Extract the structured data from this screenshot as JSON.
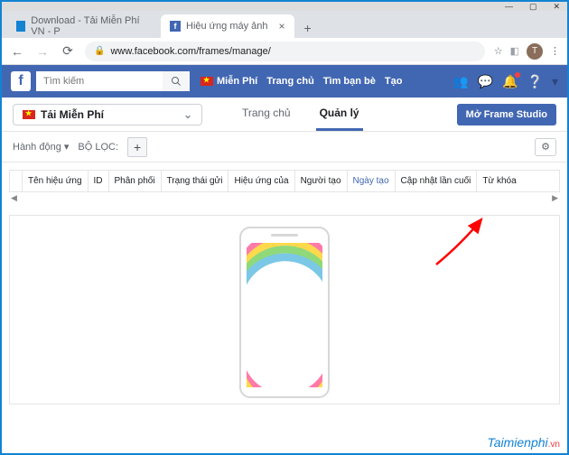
{
  "window": {
    "tab1": "Download - Tải Miễn Phí VN - P",
    "tab2": "Hiệu ứng máy ảnh"
  },
  "browser": {
    "url": "www.facebook.com/frames/manage/",
    "avatar_letter": "T"
  },
  "search": {
    "placeholder": "Tìm kiếm"
  },
  "fbnav": {
    "mienphi": "Miễn Phí",
    "home": "Trang chủ",
    "findfriends": "Tìm bạn bè",
    "create": "Tạo"
  },
  "page": {
    "name": "Tải Miễn Phí"
  },
  "subtabs": {
    "home": "Trang chủ",
    "manage": "Quản lý"
  },
  "buttons": {
    "open_studio": "Mở Frame Studio"
  },
  "toolbar": {
    "action": "Hành động",
    "filter": "BỘ LỌC:"
  },
  "cols": {
    "name": "Tên hiệu ứng",
    "id": "ID",
    "dist": "Phân phối",
    "status": "Trạng thái gửi",
    "owner": "Hiệu ứng của",
    "creator": "Người tạo",
    "created": "Ngày tạo",
    "updated": "Cập nhật lần cuối",
    "keywords": "Từ khóa"
  },
  "watermark": {
    "text": "Taimienphi",
    "suffix": ".vn"
  }
}
